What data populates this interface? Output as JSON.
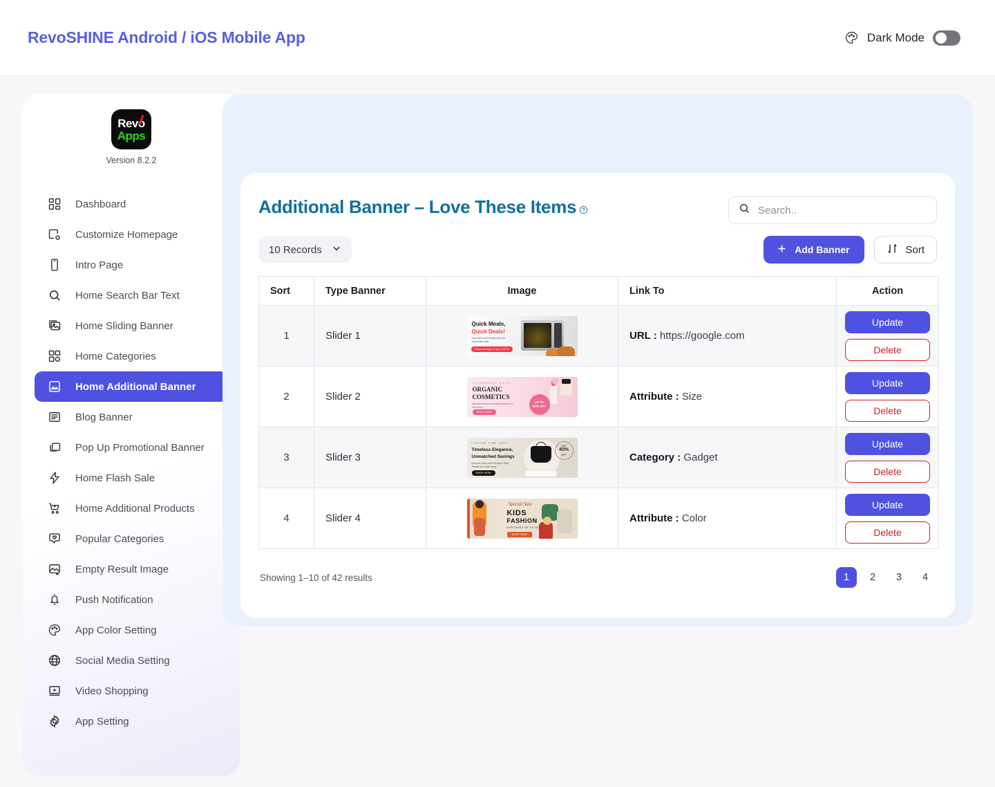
{
  "topbar": {
    "brand_title": "RevoSHINE Android / iOS Mobile App",
    "dark_mode_label": "Dark Mode",
    "palette_icon": "palette-icon",
    "toggle_state": "off"
  },
  "sidebar": {
    "logo_line1": "Revo",
    "logo_line2": "Apps",
    "version": "Version 8.2.2",
    "items": [
      {
        "label": "Dashboard",
        "icon": "grid-icon",
        "active": false
      },
      {
        "label": "Customize Homepage",
        "icon": "image-gear-icon",
        "active": false
      },
      {
        "label": "Intro Page",
        "icon": "phone-icon",
        "active": false
      },
      {
        "label": "Home Search Bar Text",
        "icon": "search-icon",
        "active": false
      },
      {
        "label": "Home Sliding Banner",
        "icon": "images-icon",
        "active": false
      },
      {
        "label": "Home Categories",
        "icon": "grid-dot-icon",
        "active": false
      },
      {
        "label": "Home Additional Banner",
        "icon": "picture-icon",
        "active": true
      },
      {
        "label": "Blog Banner",
        "icon": "article-icon",
        "active": false
      },
      {
        "label": "Pop Up Promotional Banner",
        "icon": "windows-icon",
        "active": false
      },
      {
        "label": "Home Flash Sale",
        "icon": "bolt-icon",
        "active": false
      },
      {
        "label": "Home Additional Products",
        "icon": "cart-plus-icon",
        "active": false
      },
      {
        "label": "Popular Categories",
        "icon": "heart-chat-icon",
        "active": false
      },
      {
        "label": "Empty Result Image",
        "icon": "image-x-icon",
        "active": false
      },
      {
        "label": "Push Notification",
        "icon": "bell-icon",
        "active": false
      },
      {
        "label": "App Color Setting",
        "icon": "palette-icon",
        "active": false
      },
      {
        "label": "Social Media Setting",
        "icon": "globe-icon",
        "active": false
      },
      {
        "label": "Video Shopping",
        "icon": "video-icon",
        "active": false
      },
      {
        "label": "App Setting",
        "icon": "gear-icon",
        "active": false
      }
    ]
  },
  "main": {
    "title": "Additional Banner – Love These Items",
    "help_icon": "question-circle-icon",
    "search": {
      "placeholder": "Search..",
      "value": "",
      "icon": "search-icon"
    },
    "records_select": {
      "label": "10 Records",
      "icon": "chevron-down-icon"
    },
    "add_button": {
      "label": "Add Banner",
      "icon": "plus-icon"
    },
    "sort_button": {
      "label": "Sort",
      "icon": "sort-arrows-icon"
    },
    "table": {
      "columns": [
        "Sort",
        "Type Banner",
        "Image",
        "Link To",
        "Action"
      ],
      "rows": [
        {
          "sort": "1",
          "type": "Slider 1",
          "link_key": "URL :",
          "link_value": "https://google.com",
          "update": "Update",
          "delete": "Delete",
          "image": {
            "name": "microwave-banner-thumbnail",
            "headline1": "Quick Meals,",
            "headline2": "Quick Deals!",
            "body": "Save time and money with our microwave sale.",
            "cta": "Enjoy savings of up to 28 %!"
          }
        },
        {
          "sort": "2",
          "type": "Slider 2",
          "link_key": "Attribute :",
          "link_value": "Size",
          "update": "Update",
          "delete": "Delete",
          "image": {
            "name": "organic-cosmetics-banner-thumbnail",
            "kicker": "CLEARANCE SALE",
            "headline1": "ORGANIC",
            "headline2": "COSMETICS",
            "body": "Big discounts for all feature products of this week.",
            "cta": "SHOP NOW",
            "badge_top": "UP TO",
            "badge_bottom": "80% OFF"
          }
        },
        {
          "sort": "3",
          "type": "Slider 3",
          "link_key": "Category :",
          "link_value": "Gadget",
          "update": "Update",
          "delete": "Delete",
          "image": {
            "name": "handbag-banner-thumbnail",
            "kicker": "LIMITED TIME ONLY",
            "headline1": "Timeless Elegance,",
            "headline2": "Unmatched Savings",
            "body": "Discover luxury iconic designer bags. Elevate your style today!",
            "cta": "SHOP NOW",
            "badge_top": "GET",
            "badge_mid": "40%",
            "badge_bottom": "OFF"
          }
        },
        {
          "sort": "4",
          "type": "Slider 4",
          "link_key": "Attribute :",
          "link_value": "Color",
          "update": "Update",
          "delete": "Delete",
          "image": {
            "name": "kids-fashion-banner-thumbnail",
            "script": "Special Sale",
            "headline1": "KIDS",
            "headline2": "FASHION",
            "body": "DISCOUNT UP TO 60%",
            "cta": "SHOP NOW"
          }
        }
      ]
    },
    "footer": {
      "showing": "Showing 1–10 of 42 results",
      "pages": [
        "1",
        "2",
        "3",
        "4"
      ],
      "active_page": "1"
    }
  },
  "colors": {
    "brand_purple": "#4f51e0",
    "title_teal": "#10709d",
    "delete_red": "#c8232c",
    "panel_blue": "#e9f1fc"
  }
}
